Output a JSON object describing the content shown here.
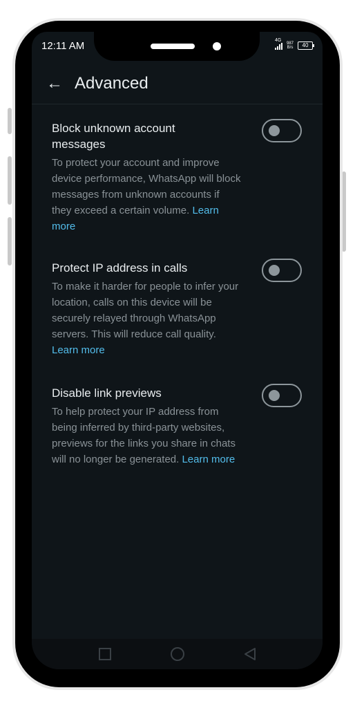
{
  "status_bar": {
    "time": "12:11 AM",
    "network": "4G",
    "speed_value": "987",
    "speed_unit": "B/s",
    "battery": "40"
  },
  "app_bar": {
    "back_icon": "arrow-left-icon",
    "title": "Advanced"
  },
  "settings": [
    {
      "title": "Block unknown account messages",
      "description": "To protect your account and improve device performance, WhatsApp will block messages from unknown accounts if they exceed a certain volume. ",
      "link": "Learn more",
      "enabled": false
    },
    {
      "title": "Protect IP address in calls",
      "description": "To make it harder for people to infer your location, calls on this device will be securely relayed through WhatsApp servers. This will reduce call quality. ",
      "link": "Learn more",
      "enabled": false
    },
    {
      "title": "Disable link previews",
      "description": "To help protect your IP address from being inferred by third-party websites, previews for the links you share in chats will no longer be generated. ",
      "link": "Learn more",
      "enabled": false
    }
  ],
  "nav_bar": [
    "recents-square-icon",
    "home-circle-icon",
    "back-triangle-icon"
  ],
  "colors": {
    "background": "#0f1519",
    "text_primary": "#e9edef",
    "text_secondary": "#8a9297",
    "link": "#53bdeb",
    "toggle_off": "#8d969b"
  }
}
